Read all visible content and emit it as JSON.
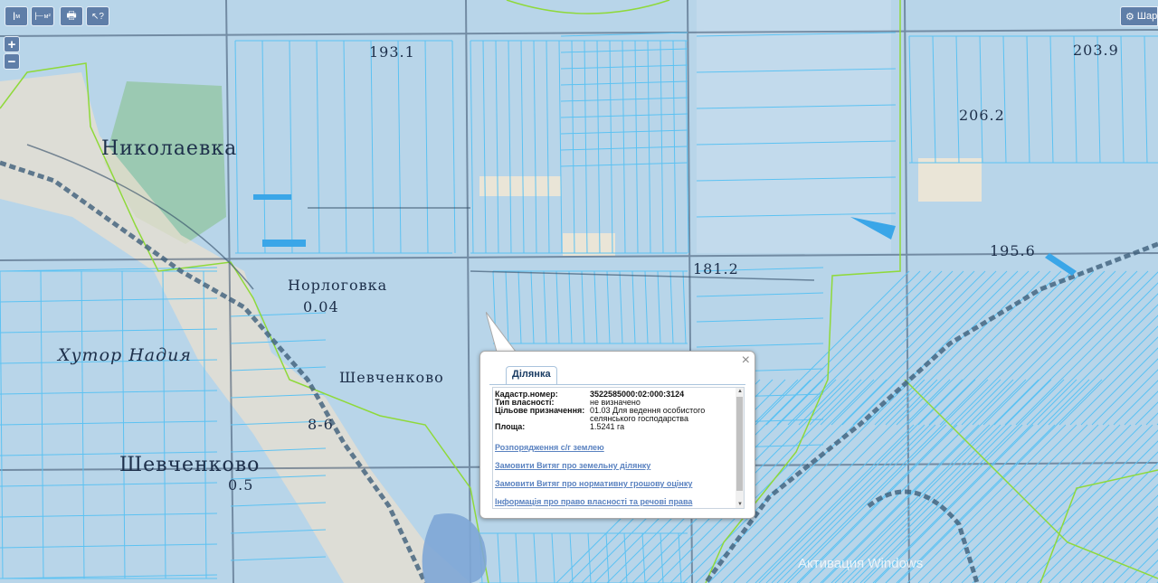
{
  "toolbar": {
    "buttons": [
      {
        "name": "measure-distance-button",
        "glyph": "I",
        "sub": "м"
      },
      {
        "name": "measure-area-button",
        "glyph": "⊢",
        "sub": "м²"
      },
      {
        "name": "print-button",
        "glyph": "🖶"
      },
      {
        "name": "identify-button",
        "glyph": "↖?"
      }
    ]
  },
  "zoom": {
    "in": "+",
    "out": "−"
  },
  "layers_button": {
    "label": "Шар"
  },
  "map_labels": [
    {
      "text": "Николаевка",
      "class": ""
    },
    {
      "text": "Норлоговка",
      "class": "small"
    },
    {
      "text": "Хутор Надия",
      "class": "italic"
    },
    {
      "text": "Шевченково",
      "class": ""
    },
    {
      "text": "Шевченково",
      "class": "small"
    },
    {
      "text": "193.1",
      "class": "small"
    },
    {
      "text": "203.9",
      "class": "small"
    },
    {
      "text": "206.2",
      "class": "small"
    },
    {
      "text": "181.2",
      "class": "small"
    },
    {
      "text": "195.6",
      "class": "small"
    },
    {
      "text": "0.04",
      "class": "small"
    },
    {
      "text": "8-6",
      "class": "small"
    },
    {
      "text": "0.5",
      "class": "small"
    }
  ],
  "popup": {
    "close": "×",
    "tab": "Ділянка",
    "fields": [
      {
        "key": "Кадастр.номер:",
        "value": "3522585000:02:000:3124"
      },
      {
        "key": "Тип власності:",
        "value": "не визначено"
      },
      {
        "key": "Цільове призначення:",
        "value": "01.03 Для ведення особистого селянського господарства"
      },
      {
        "key": "Площа:",
        "value": "1.5241 га"
      }
    ],
    "links": [
      "Розпорядження с/г землею",
      "Замовити Витяг про земельну ділянку",
      "Замовити Витяг про нормативну грошову оцінку",
      "Інформація про право власності та речові права"
    ]
  },
  "watermark": "Активация Windows",
  "colors": {
    "parcel": "#63c5f2",
    "boundary": "#8fd93a",
    "road": "#3e5f7a",
    "forest": "#86c48a"
  }
}
